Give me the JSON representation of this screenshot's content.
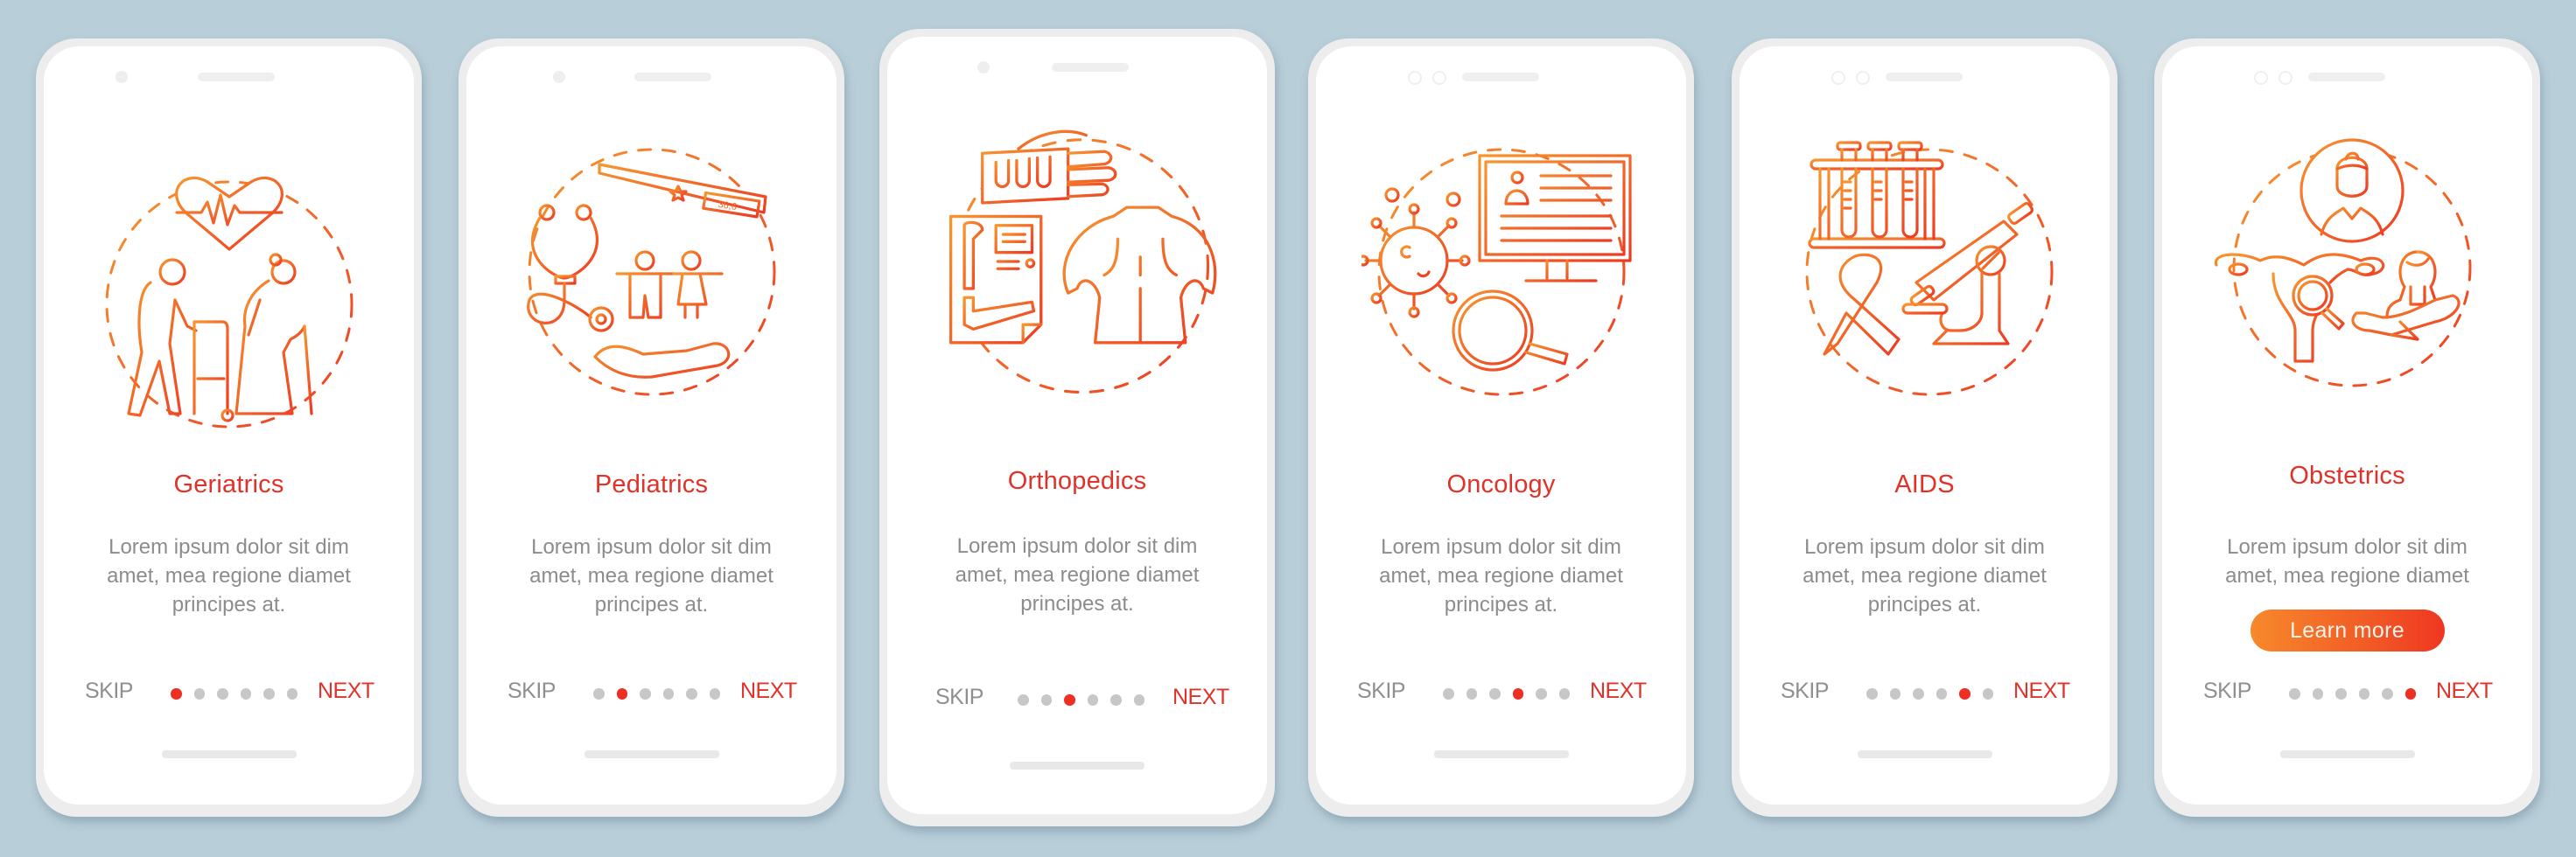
{
  "colors": {
    "background": "#B8CED9",
    "accent": "#E1322A",
    "body_text": "#8C8C8C",
    "dot_inactive": "#C7C7C7",
    "dot_active": "#EE2F24",
    "button_gradient_start": "#F7892B",
    "button_gradient_end": "#EF3622"
  },
  "nav": {
    "skip_label": "SKIP",
    "next_label": "NEXT",
    "total_steps": 6
  },
  "body_lines": [
    "Lorem ipsum dolor sit dim",
    "amet, mea regione diamet",
    "principes at."
  ],
  "screens": [
    {
      "title": "Geriatrics",
      "icon": "elderly-couple-heart-icon",
      "active_step": 1,
      "body": [
        "Lorem ipsum dolor sit dim",
        "amet, mea regione diamet",
        "principes at."
      ]
    },
    {
      "title": "Pediatrics",
      "icon": "stethoscope-thermometer-children-icon",
      "active_step": 2,
      "thermometer_reading": "36,6",
      "body": [
        "Lorem ipsum dolor sit dim",
        "amet, mea regione diamet",
        "principes at."
      ]
    },
    {
      "title": "Orthopedics",
      "icon": "cast-xray-spine-icon",
      "active_step": 3,
      "body": [
        "Lorem ipsum dolor sit dim",
        "amet, mea regione diamet",
        "principes at."
      ]
    },
    {
      "title": "Oncology",
      "icon": "virus-monitor-magnifier-icon",
      "active_step": 4,
      "body": [
        "Lorem ipsum dolor sit dim",
        "amet, mea regione diamet",
        "principes at."
      ]
    },
    {
      "title": "AIDS",
      "icon": "test-tubes-ribbon-microscope-icon",
      "active_step": 5,
      "body": [
        "Lorem ipsum dolor sit dim",
        "amet, mea regione diamet",
        "principes at."
      ]
    },
    {
      "title": "Obstetrics",
      "icon": "uterus-doctor-patient-icon",
      "active_step": 6,
      "body": [
        "Lorem ipsum dolor sit dim",
        "amet, mea regione diamet"
      ],
      "button_label": "Learn more"
    }
  ]
}
